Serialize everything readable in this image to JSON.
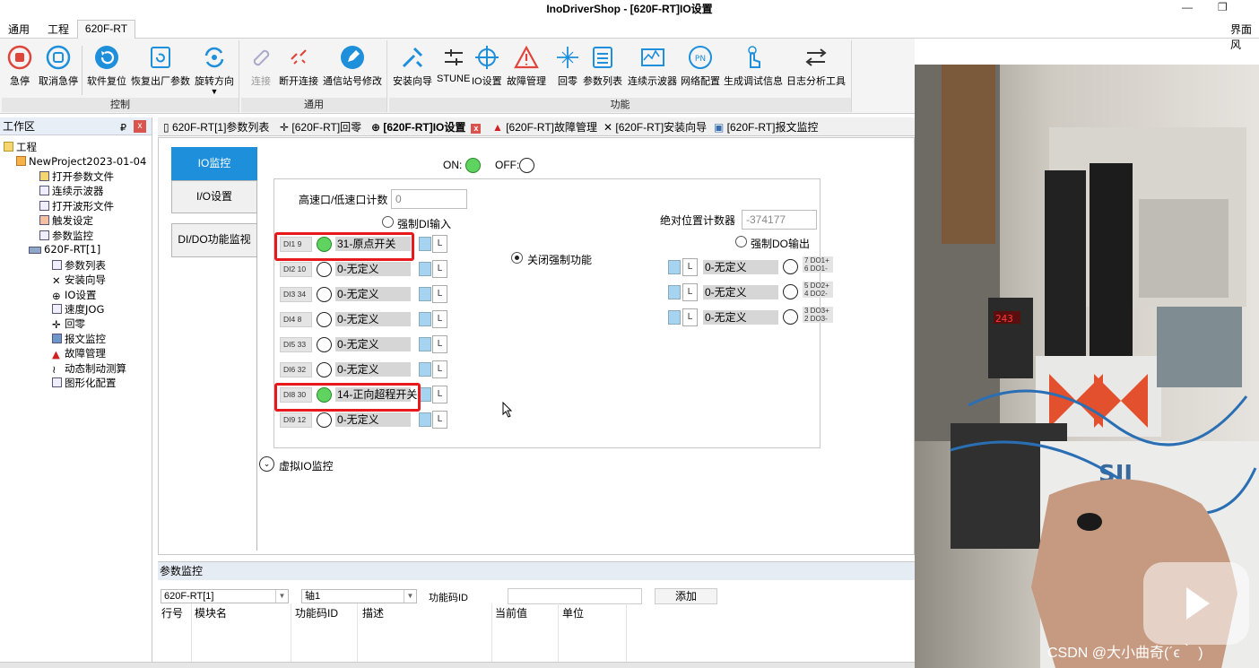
{
  "window": {
    "title": "InoDriverShop - [620F-RT]IO设置"
  },
  "menu": {
    "tabs": [
      "通用",
      "工程",
      "620F-RT"
    ],
    "right_label": "界面风"
  },
  "ribbon": {
    "groups": [
      {
        "label": "控制",
        "buttons": [
          "急停",
          "取消急停",
          "软件复位",
          "恢复出厂参数",
          "旋转方向"
        ]
      },
      {
        "label": "通用",
        "buttons": [
          "连接",
          "断开连接",
          "通信站号修改"
        ]
      },
      {
        "label": "功能",
        "buttons": [
          "安装向导",
          "STUNE",
          "IO设置",
          "故障管理",
          "回零",
          "参数列表",
          "连续示波器",
          "网络配置",
          "生成调试信息",
          "日志分析工具"
        ]
      }
    ]
  },
  "workspace": {
    "title": "工作区",
    "pin": "₽",
    "close": "x",
    "tree": [
      "工程",
      "NewProject2023-01-04",
      "打开参数文件",
      "连续示波器",
      "打开波形文件",
      "触发设定",
      "参数监控",
      "620F-RT[1]",
      "参数列表",
      "安装向导",
      "IO设置",
      "速度JOG",
      "回零",
      "报文监控",
      "故障管理",
      "动态制动测算",
      "图形化配置"
    ]
  },
  "doc_tabs": [
    "620F-RT[1]参数列表",
    "[620F-RT]回零",
    "[620F-RT]IO设置",
    "[620F-RT]故障管理",
    "[620F-RT]安装向导",
    "[620F-RT]报文监控"
  ],
  "side_tabs": [
    "IO监控",
    "I/O设置",
    "DI/DO功能监视"
  ],
  "io": {
    "on_label": "ON:",
    "off_label": "OFF:",
    "hs_counter_label": "高速口/低速口计数",
    "hs_counter_value": "0",
    "force_di_label": "强制DI输入",
    "abs_counter_label": "绝对位置计数器",
    "abs_counter_value": "-374177",
    "force_do_label": "强制DO输出",
    "close_force_label": "关闭强制功能",
    "virtual_io_label": "虚拟IO监控",
    "L": "L",
    "di": [
      {
        "tag": "DI1 9",
        "value": "31-原点开关",
        "on": true
      },
      {
        "tag": "DI2 10",
        "value": "0-无定义",
        "on": false
      },
      {
        "tag": "DI3 34",
        "value": "0-无定义",
        "on": false
      },
      {
        "tag": "DI4 8",
        "value": "0-无定义",
        "on": false
      },
      {
        "tag": "DI5 33",
        "value": "0-无定义",
        "on": false
      },
      {
        "tag": "DI6 32",
        "value": "0-无定义",
        "on": false
      },
      {
        "tag": "DI8 30",
        "value": "14-正向超程开关",
        "on": true
      },
      {
        "tag": "DI9 12",
        "value": "0-无定义",
        "on": false
      }
    ],
    "do": [
      {
        "value": "0-无定义",
        "tag1": "7 DO1+",
        "tag2": "6 DO1-"
      },
      {
        "value": "0-无定义",
        "tag1": "5 DO2+",
        "tag2": "4 DO2-"
      },
      {
        "value": "0-无定义",
        "tag1": "3 DO3+",
        "tag2": "2 DO3-"
      }
    ]
  },
  "param_monitor": {
    "title": "参数监控",
    "device": "620F-RT[1]",
    "axis": "轴1",
    "code_label": "功能码ID",
    "add_label": "添加",
    "columns": [
      "行号",
      "模块名",
      "功能码ID",
      "描述",
      "当前值",
      "单位"
    ]
  },
  "photo": {
    "watermark": "CSDN @大小曲奇(´ϵ｀ )"
  },
  "colors": {
    "accent": "#1e8fdb",
    "on": "#5fd35f",
    "highlight": "#e8191c"
  }
}
